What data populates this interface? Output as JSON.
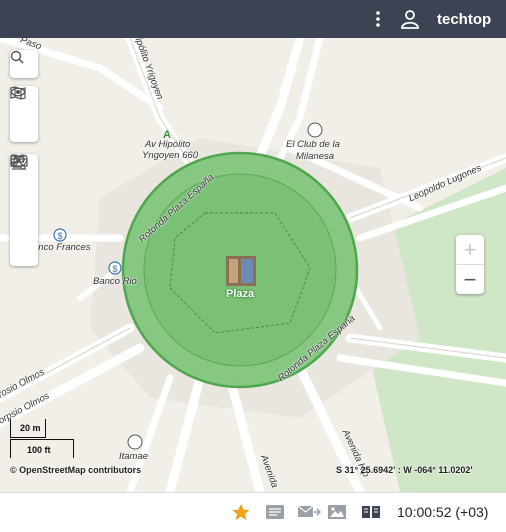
{
  "header": {
    "username": "techtop",
    "menu_icon": "kebab-menu-icon",
    "user_icon": "user-icon"
  },
  "map": {
    "place_label": "Plaza",
    "zoom_in": "+",
    "zoom_out": "−",
    "labels": {
      "av_hipolito": "Av Hipólito",
      "yngoyen": "Yngoyen 660",
      "el_club": "El Club de la",
      "milanesa": "Milanesa",
      "rotonda_top": "Rotonda Plaza España",
      "rotonda_bottom": "Rotonda Plaza España",
      "leopoldo": "Leopoldo Lugones",
      "banco_frances": "anco Frances",
      "banco_rio": "Banco Rio",
      "hipolito_road": "Hipólito Yrigoyen",
      "osio_olmos": "rosio Olmos",
      "orpsio_olmos": "orpsio Olmos",
      "itamae": "Itamae",
      "avenida": "Avenida Hip",
      "avenida2": "Avenida",
      "top_left": "Paso"
    },
    "scale": {
      "metric": "20 m",
      "imperial": "100 ft"
    },
    "attribution": "© OpenStreetMap contributors",
    "coordinates": "S 31° 25.6942' : W -064° 11.0202'"
  },
  "footer": {
    "time": "10:00:52 (+03)"
  },
  "colors": {
    "header_bg": "#3c4352",
    "geofence_fill": "#7dc47a",
    "geofence_stroke": "#4fa64c",
    "star": "#f0a21a"
  }
}
